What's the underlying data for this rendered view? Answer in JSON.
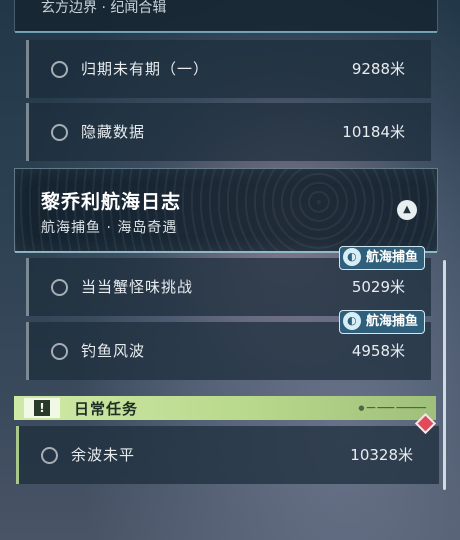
{
  "previous_chapter": {
    "subtitle": "玄方边界 · 纪闻合辑"
  },
  "chapter_1_quests": [
    {
      "name": "归期未有期（一）",
      "distance": "9288米"
    },
    {
      "name": "隐藏数据",
      "distance": "10184米"
    }
  ],
  "chapter": {
    "title": "黎乔利航海日志",
    "subtitle": "航海捕鱼 · 海岛奇遇",
    "collapse_icon": "chevron-up-icon"
  },
  "chapter_2_quests": [
    {
      "name": "当当蟹怪味挑战",
      "distance": "5029米",
      "tag": "航海捕鱼"
    },
    {
      "name": "钓鱼风波",
      "distance": "4958米",
      "tag": "航海捕鱼"
    }
  ],
  "daily": {
    "header": "日常任务",
    "header_icon": "!",
    "decoration": "● ━━ ━━━━ ━━━━━━━",
    "quests": [
      {
        "name": "余波未平",
        "distance": "10328米"
      }
    ]
  },
  "colors": {
    "daily_accent": "#b9d98c",
    "tag_bg": "#2f5f7a",
    "alert_diamond": "#e24a5a"
  }
}
